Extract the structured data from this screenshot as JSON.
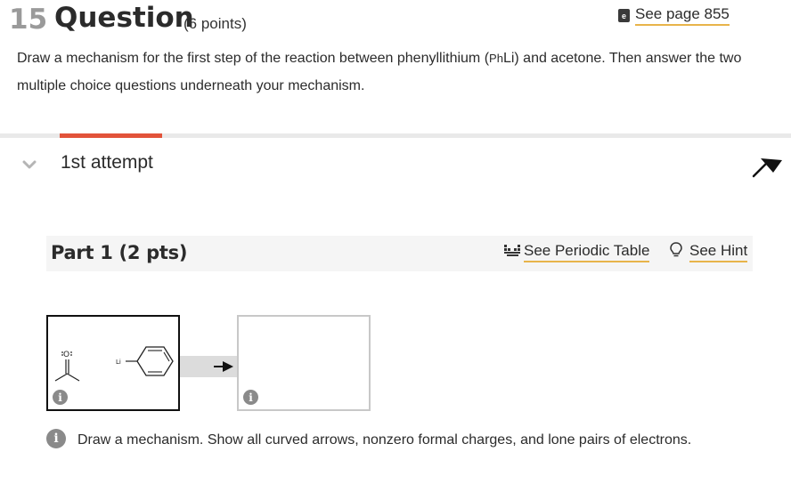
{
  "question": {
    "number": "15",
    "title": "Question",
    "points": "(6 points)",
    "see_page": "See page 855",
    "text_before": "Draw a mechanism for the first step of the reaction between phenyllithium (",
    "text_chem": "Ph",
    "text_after": "Li) and acetone. Then answer the two multiple choice questions underneath your mechanism."
  },
  "attempt": {
    "label": "1st attempt"
  },
  "part": {
    "title": "Part 1 (2 pts)",
    "periodic_table_label": "See Periodic Table",
    "hint_label": "See Hint"
  },
  "reactants": {
    "li_label": "Li",
    "oxygen_label": "O"
  },
  "instruction": "Draw a mechanism. Show all curved arrows, nonzero formal charges, and lone pairs of electrons.",
  "colors": {
    "accent_tab": "#e2533a",
    "link_underline": "#e8b44a",
    "number_gray": "#9a9a9a"
  },
  "icons": [
    "book-icon",
    "chevron-down-icon",
    "flag-icon",
    "periodic-table-icon",
    "lightbulb-icon",
    "info-icon"
  ]
}
